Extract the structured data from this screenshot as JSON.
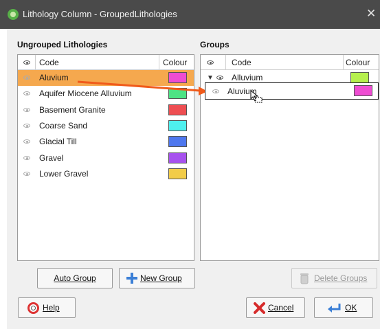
{
  "window": {
    "title": "Lithology Column - GroupedLithologies",
    "close_glyph": "✕"
  },
  "ungrouped": {
    "label": "Ungrouped Lithologies",
    "columns": {
      "code": "Code",
      "colour": "Colour"
    },
    "rows": [
      {
        "name": "Aluvium",
        "color": "#ee4cd2",
        "selected": true
      },
      {
        "name": "Aquifer Miocene Alluvium",
        "color": "#4de384",
        "selected": false
      },
      {
        "name": "Basement Granite",
        "color": "#ee4e52",
        "selected": false
      },
      {
        "name": "Coarse Sand",
        "color": "#4ef0ee",
        "selected": false
      },
      {
        "name": "Glacial Till",
        "color": "#4e77ee",
        "selected": false
      },
      {
        "name": "Gravel",
        "color": "#a752ee",
        "selected": false
      },
      {
        "name": "Lower Gravel",
        "color": "#f2cc48",
        "selected": false
      }
    ]
  },
  "groups": {
    "label": "Groups",
    "columns": {
      "code": "Code",
      "colour": "Colour"
    },
    "rows": [
      {
        "name": "Alluvium",
        "color": "#b6f04e",
        "expanded": true
      }
    ]
  },
  "drag": {
    "label": "Aluvium",
    "color": "#ee4cd2",
    "arrow_color": "#f05a1a"
  },
  "buttons": {
    "auto_group": "Auto Group",
    "new_group": "New Group",
    "delete_groups": "Delete Groups",
    "help": "Help",
    "cancel": "Cancel",
    "ok": "OK"
  }
}
